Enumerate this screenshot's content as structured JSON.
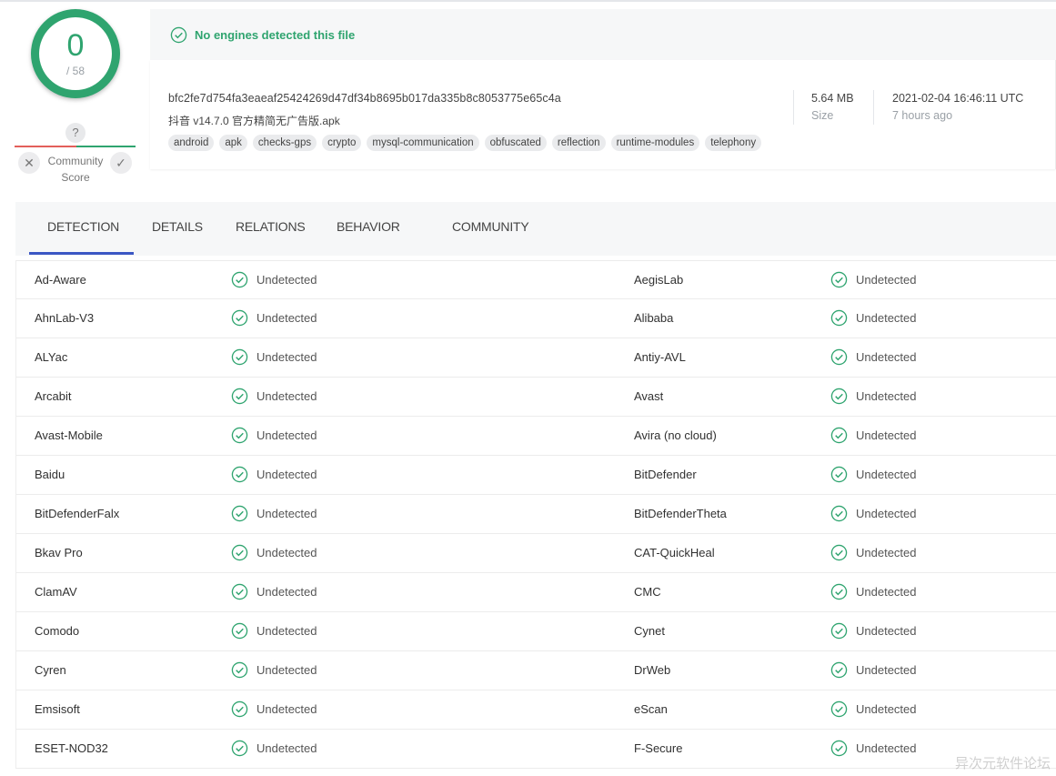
{
  "score": {
    "detections": "0",
    "total": "/ 58"
  },
  "community": {
    "question": "?",
    "label_line1": "Community",
    "label_line2": "Score",
    "dislike": "✕",
    "like": "✓"
  },
  "verdict": {
    "text": "No engines detected this file"
  },
  "file": {
    "hash": "bfc2fe7d754fa3eaeaf25424269d47df34b8695b017da335b8c8053775e65c4a",
    "name": "抖音 v14.7.0 官方精简无广告版.apk",
    "size": "5.64 MB",
    "size_label": "Size",
    "date": "2021-02-04 16:46:11 UTC",
    "date_relative": "7 hours ago"
  },
  "tags": [
    "android",
    "apk",
    "checks-gps",
    "crypto",
    "mysql-communication",
    "obfuscated",
    "reflection",
    "runtime-modules",
    "telephony"
  ],
  "tabs": [
    "DETECTION",
    "DETAILS",
    "RELATIONS",
    "BEHAVIOR",
    "COMMUNITY"
  ],
  "active_tab": "DETECTION",
  "colors": {
    "accent_green": "#2fa46f",
    "tab_underline": "#3b57c4",
    "community_red": "#e35f5a"
  },
  "detections": [
    {
      "left": "Ad-Aware",
      "left_result": "Undetected",
      "right": "AegisLab",
      "right_result": "Undetected"
    },
    {
      "left": "AhnLab-V3",
      "left_result": "Undetected",
      "right": "Alibaba",
      "right_result": "Undetected"
    },
    {
      "left": "ALYac",
      "left_result": "Undetected",
      "right": "Antiy-AVL",
      "right_result": "Undetected"
    },
    {
      "left": "Arcabit",
      "left_result": "Undetected",
      "right": "Avast",
      "right_result": "Undetected"
    },
    {
      "left": "Avast-Mobile",
      "left_result": "Undetected",
      "right": "Avira (no cloud)",
      "right_result": "Undetected"
    },
    {
      "left": "Baidu",
      "left_result": "Undetected",
      "right": "BitDefender",
      "right_result": "Undetected"
    },
    {
      "left": "BitDefenderFalx",
      "left_result": "Undetected",
      "right": "BitDefenderTheta",
      "right_result": "Undetected"
    },
    {
      "left": "Bkav Pro",
      "left_result": "Undetected",
      "right": "CAT-QuickHeal",
      "right_result": "Undetected"
    },
    {
      "left": "ClamAV",
      "left_result": "Undetected",
      "right": "CMC",
      "right_result": "Undetected"
    },
    {
      "left": "Comodo",
      "left_result": "Undetected",
      "right": "Cynet",
      "right_result": "Undetected"
    },
    {
      "left": "Cyren",
      "left_result": "Undetected",
      "right": "DrWeb",
      "right_result": "Undetected"
    },
    {
      "left": "Emsisoft",
      "left_result": "Undetected",
      "right": "eScan",
      "right_result": "Undetected"
    },
    {
      "left": "ESET-NOD32",
      "left_result": "Undetected",
      "right": "F-Secure",
      "right_result": "Undetected"
    }
  ],
  "watermark": "异次元软件论坛"
}
